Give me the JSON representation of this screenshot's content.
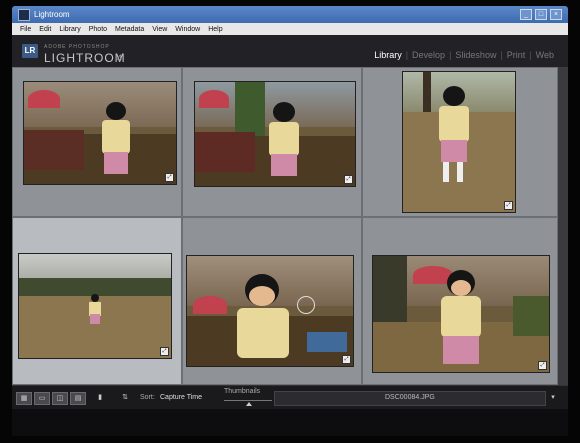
{
  "window": {
    "title": "Lightroom",
    "controls": [
      "_",
      "□",
      "×"
    ]
  },
  "menu": [
    "File",
    "Edit",
    "Library",
    "Photo",
    "Metadata",
    "View",
    "Window",
    "Help"
  ],
  "identity": {
    "badge": "LR",
    "brand_small": "ADOBE PHOTOSHOP",
    "brand_big": "LIGHTROOM",
    "version": "4"
  },
  "modules": [
    {
      "label": "Library",
      "active": true
    },
    {
      "label": "Develop",
      "active": false
    },
    {
      "label": "Slideshow",
      "active": false
    },
    {
      "label": "Print",
      "active": false
    },
    {
      "label": "Web",
      "active": false
    }
  ],
  "toolbar": {
    "sort_label": "Sort:",
    "sort_value": "Capture Time",
    "thumbnails_label": "Thumbnails",
    "filename": "DSC00084.JPG",
    "icons": [
      "grid-view-icon",
      "loupe-view-icon",
      "compare-view-icon",
      "survey-view-icon",
      "spray-can-icon",
      "sort-direction-icon"
    ]
  },
  "colors": {
    "active_module": "#ffffff",
    "inactive_module": "#777777",
    "cell_bg": "#8f9398",
    "cell_selected_bg": "#b8bcc0",
    "panel_bg": "#222226"
  }
}
